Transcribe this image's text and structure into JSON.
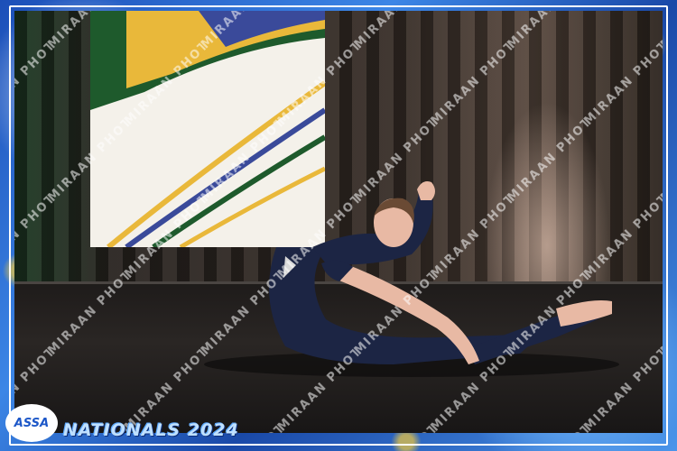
{
  "photo": {
    "subject": "dancer",
    "watermark_text": "MIRAAN PHOTOGRAPHY"
  },
  "branding": {
    "logo_text": "ASSA",
    "event_title": "NATIONALS 2024"
  },
  "colors": {
    "frame_blue": "#2a6fd0",
    "frame_accent_gold": "#f0c83c",
    "costume_navy": "#1c2544",
    "title_text": "#bfe0ff"
  }
}
